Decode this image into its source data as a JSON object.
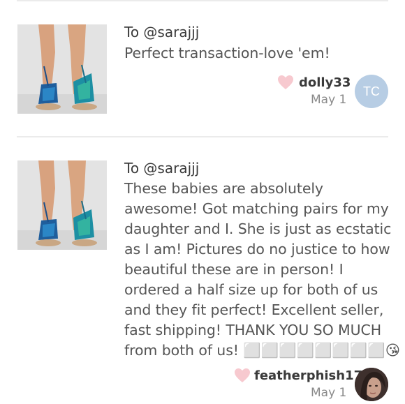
{
  "comments": [
    {
      "to_prefix": "To ",
      "recipient": "@sarajjj",
      "message": "Perfect transaction-love 'em!",
      "username": "dolly33",
      "date": "May 1",
      "avatar_initials": "TC",
      "avatar_color": "#b7cde4",
      "image": "sandals-photo"
    },
    {
      "to_prefix": "To ",
      "recipient": "@sarajjj",
      "message_lines": [
        "These babies are absolutely",
        "awesome! Got matching pairs for my",
        "daughter and I. She is just as ecstatic",
        "as I am! Pictures do no justice to how",
        "beautiful these are in person! I",
        "ordered a half size up for both of us",
        "and they fit perfect! Excellent seller,",
        "fast shipping! THANK YOU SO MUCH",
        "from both of us! ⬜⬜⬜⬜⬜⬜⬜⬜😘"
      ],
      "username": "featherphish17",
      "date": "May 1",
      "avatar": "user-photo",
      "image": "sandals-photo"
    }
  ],
  "colors": {
    "heart": "#f7c9cf",
    "divider": "#ebebeb",
    "username": "#3a3a3a",
    "date": "#8a8a8a"
  }
}
